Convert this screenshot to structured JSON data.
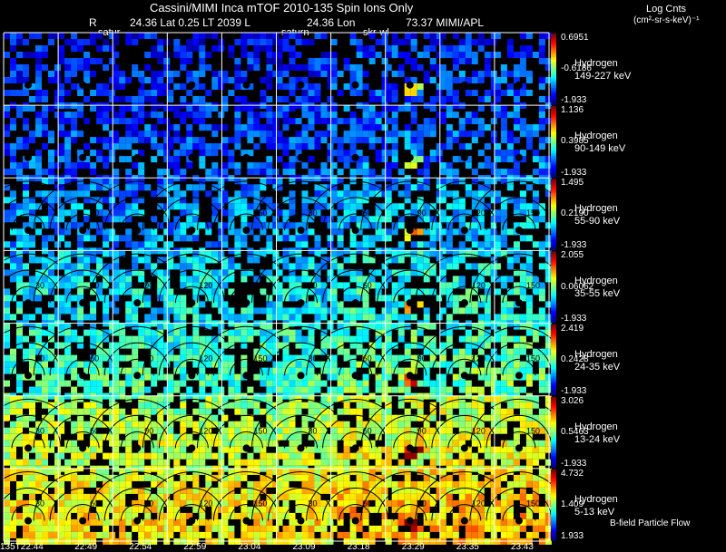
{
  "header": {
    "title": "Cassini/MIMI Inca mTOF  2010-135   Spin    Ions Only",
    "r_label": "R",
    "coords": "24.36 Lat 0.25 LT 2039 L",
    "lon": "24.36 Lon",
    "mimi": "73.37  MIMI/APL",
    "tag_satur": "satur",
    "tag_saturn": "saturn",
    "tag_skr": "skr-wl"
  },
  "colorbar_title": "Log Cnts",
  "colorbar_units": "(cm²-sr-s-keV)⁻¹",
  "footer_note": "B-field Particle Flow",
  "chart_data": {
    "type": "heatmap",
    "panels_per_row": 10,
    "rows": [
      {
        "species": "Hydrogen",
        "energy": "149-227 keV",
        "max": "0.6951",
        "mid": "-0.6186",
        "min": "-1.933",
        "level": 0.18
      },
      {
        "species": "Hydrogen",
        "energy": "90-149 keV",
        "max": "1.136",
        "mid": "0.3985",
        "min": "-1.933",
        "level": 0.22
      },
      {
        "species": "Hydrogen",
        "energy": "55-90 keV",
        "max": "1.495",
        "mid": "0.2190",
        "min": "-1.933",
        "level": 0.3
      },
      {
        "species": "Hydrogen",
        "energy": "35-55 keV",
        "max": "2.055",
        "mid": "0.06062",
        "min": "-1.933",
        "level": 0.38
      },
      {
        "species": "Hydrogen",
        "energy": "24-35 keV",
        "max": "2.419",
        "mid": "0.2428",
        "min": "-1.933",
        "level": 0.45
      },
      {
        "species": "Hydrogen",
        "energy": "13-24 keV",
        "max": "3.026",
        "mid": "0.5463",
        "min": "-1.933",
        "level": 0.58
      },
      {
        "species": "Hydrogen",
        "energy": "5-13 keV",
        "max": "4.732",
        "mid": "1.409",
        "min": "1.933",
        "level": 0.66
      }
    ],
    "contour_labels": [
      "30",
      "60",
      "90",
      "120",
      "150"
    ],
    "time_labels": [
      "135T22:44",
      "22:49",
      "22:54",
      "22:59",
      "23:04",
      "23:09",
      "23:18",
      "23:29",
      "23:35",
      "23:43"
    ]
  }
}
